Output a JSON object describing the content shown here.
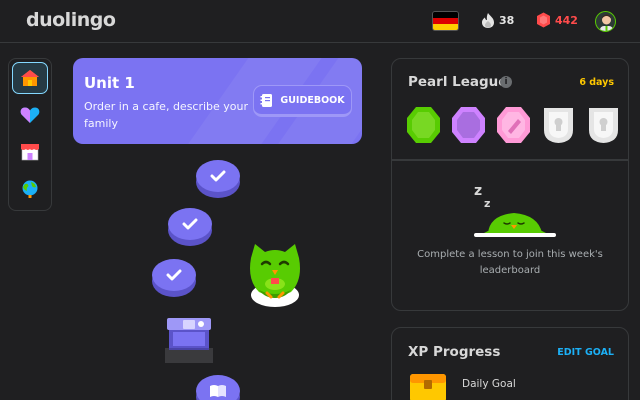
{
  "header": {
    "logo": "duolingo",
    "language": "German",
    "streak": "38",
    "gems": "442"
  },
  "nav": {
    "items": [
      "learn",
      "practice",
      "shop",
      "leagues"
    ],
    "active": "learn"
  },
  "unit": {
    "title": "Unit 1",
    "description": "Order in a cafe, describe your family",
    "guidebook_label": "GUIDEBOOK"
  },
  "path": {
    "lessons": [
      {
        "state": "completed"
      },
      {
        "state": "completed"
      },
      {
        "state": "completed"
      },
      {
        "state": "chest"
      },
      {
        "state": "current-story"
      }
    ]
  },
  "league": {
    "title": "Pearl League",
    "days_left": "6 days",
    "message": "Complete a lesson to join this week's leaderboard"
  },
  "xp_progress": {
    "title": "XP Progress",
    "edit_label": "EDIT GOAL",
    "daily_goal_label": "Daily Goal"
  },
  "colors": {
    "accent_purple": "#7b73f2",
    "streak_gray": "#ffffff",
    "gem_red": "#ff4b4b",
    "league_days": "#ffc800",
    "link_blue": "#1cb0f6"
  }
}
